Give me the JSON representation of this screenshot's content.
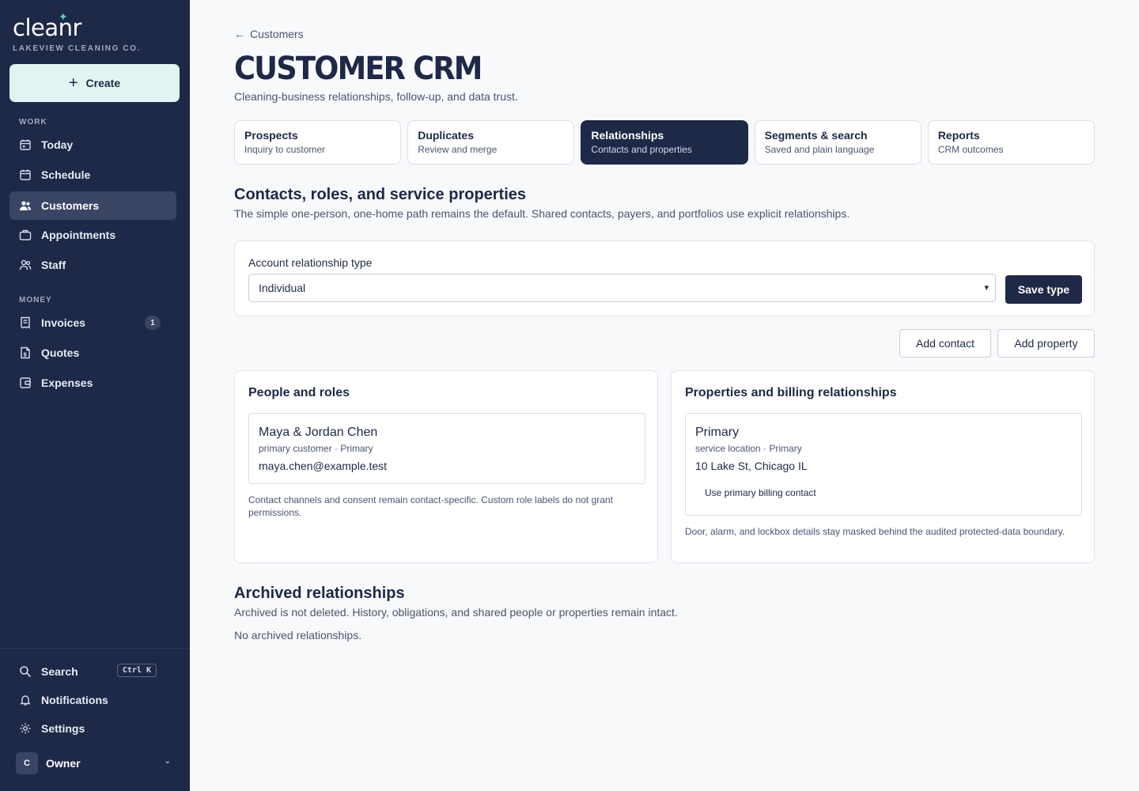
{
  "sidebar": {
    "logo": "cleanr",
    "company": "LAKEVIEW CLEANING CO.",
    "create_label": "Create",
    "work_label": "WORK",
    "money_label": "MONEY",
    "items": [
      {
        "label": "Today",
        "icon": "calendar-today-icon"
      },
      {
        "label": "Schedule",
        "icon": "calendar-icon"
      },
      {
        "label": "Customers",
        "icon": "users-icon",
        "active": true
      },
      {
        "label": "Appointments",
        "icon": "briefcase-icon"
      },
      {
        "label": "Staff",
        "icon": "staff-icon"
      },
      {
        "label": "Invoices",
        "icon": "receipt-icon",
        "badge": "1"
      },
      {
        "label": "Quotes",
        "icon": "file-dollar-icon"
      },
      {
        "label": "Expenses",
        "icon": "wallet-icon"
      }
    ],
    "bottom": {
      "search_label": "Search",
      "search_shortcut": "Ctrl K",
      "notifications_label": "Notifications",
      "settings_label": "Settings",
      "owner_initial": "C",
      "owner_label": "Owner"
    }
  },
  "header": {
    "back_label": "Customers",
    "title": "CUSTOMER CRM",
    "subtitle": "Cleaning-business relationships, follow-up, and data trust."
  },
  "tabs": [
    {
      "label": "Prospects",
      "desc": "Inquiry to customer"
    },
    {
      "label": "Duplicates",
      "desc": "Review and merge"
    },
    {
      "label": "Relationships",
      "desc": "Contacts and properties",
      "active": true
    },
    {
      "label": "Segments & search",
      "desc": "Saved and plain language"
    },
    {
      "label": "Reports",
      "desc": "CRM outcomes"
    }
  ],
  "contacts_section": {
    "title": "Contacts, roles, and service properties",
    "desc": "The simple one-person, one-home path remains the default. Shared contacts, payers, and portfolios use explicit relationships."
  },
  "relationship_type": {
    "label": "Account relationship type",
    "value": "Individual",
    "save_label": "Save type"
  },
  "actions": {
    "add_contact": "Add contact",
    "add_property": "Add property"
  },
  "people_panel": {
    "title": "People and roles",
    "contact": {
      "name": "Maya & Jordan Chen",
      "meta": "primary customer · Primary",
      "email": "maya.chen@example.test"
    },
    "note": "Contact channels and consent remain contact-specific. Custom role labels do not grant permissions."
  },
  "properties_panel": {
    "title": "Properties and billing relationships",
    "property": {
      "name": "Primary",
      "meta": "service location · Primary",
      "address": "10 Lake St, Chicago IL",
      "billing_link": "Use primary billing contact"
    },
    "note": "Door, alarm, and lockbox details stay masked behind the audited protected-data boundary."
  },
  "archived_section": {
    "title": "Archived relationships",
    "desc": "Archived is not deleted. History, obligations, and shared people or properties remain intact.",
    "empty": "No archived relationships."
  },
  "colors": {
    "sidebar_bg": "#1e2847",
    "accent": "#5fd0bd",
    "create_bg": "#e2f3f1",
    "active_tab_bg": "#1e2847"
  }
}
